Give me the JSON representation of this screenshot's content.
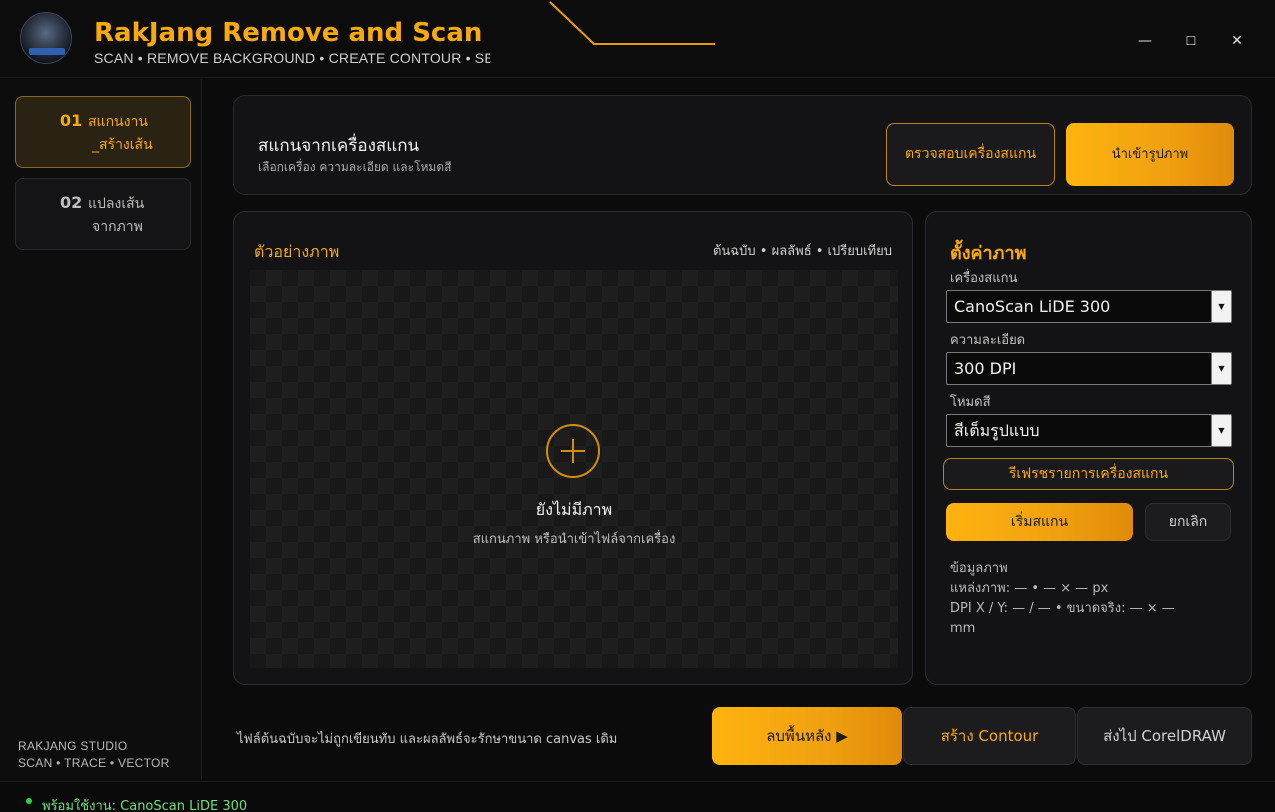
{
  "app": {
    "title": "RakJang Remove and Scan",
    "subtitle": "SCAN • REMOVE BACKGROUND • CREATE CONTOUR • SEND TO CORELDRAW"
  },
  "window_controls": {
    "minimize": "—",
    "maximize": "☐",
    "close": "✕"
  },
  "sidebar": {
    "items": [
      {
        "num": "01",
        "label": "สแกนงาน\n_สร้างเส้น",
        "active": true
      },
      {
        "num": "02",
        "label": "แปลงเส้น\nจากภาพ",
        "active": false
      }
    ],
    "studio_line1": "RAKJANG STUDIO",
    "studio_line2": "SCAN • TRACE • VECTOR"
  },
  "scan_header": {
    "title": "สแกนจากเครื่องสแกน",
    "subtitle": "เลือกเครื่อง ความละเอียด และโหมดสี",
    "check_button": "ตรวจสอบเครื่องสแกน",
    "import_button": "นำเข้ารูปภาพ"
  },
  "preview": {
    "title": "ตัวอย่างภาพ",
    "modes": "ต้นฉบับ  •  ผลลัพธ์  •  เปรียบเทียบ",
    "empty_title": "ยังไม่มีภาพ",
    "empty_subtitle": "สแกนภาพ หรือนำเข้าไฟล์จากเครื่อง"
  },
  "settings": {
    "title": "ตั้งค่าภาพ",
    "scanner_label": "เครื่องสแกน",
    "scanner_value": "CanoScan LiDE 300",
    "resolution_label": "ความละเอียด",
    "resolution_value": "300 DPI",
    "color_mode_label": "โหมดสี",
    "color_mode_value": "สีเต็มรูปแบบ",
    "refresh_button": "รีเฟรชรายการเครื่องสแกน",
    "start_button": "เริ่มสแกน",
    "cancel_button": "ยกเลิก",
    "info_title": "ข้อมูลภาพ",
    "info_source": "แหล่งภาพ: —   •   — × — px",
    "info_dpi": "DPI X / Y: — / —   •   ขนาดจริง: — × —",
    "info_unit": "mm"
  },
  "footer": {
    "note": "ไฟล์ต้นฉบับจะไม่ถูกเขียนทับ และผลลัพธ์จะรักษาขนาด canvas เดิม",
    "remove_bg_button": "ลบพื้นหลัง  ▶",
    "contour_prefix": "สร้าง ",
    "contour_word": "Contour",
    "send_button": "ส่งไป CorelDRAW"
  },
  "status": {
    "text": "พร้อมใช้งาน: CanoScan LiDE 300"
  },
  "colors": {
    "accent": "#f7a90f",
    "background": "#0b0b0c",
    "panel": "#131315",
    "status_ok": "#2fcf4a"
  }
}
